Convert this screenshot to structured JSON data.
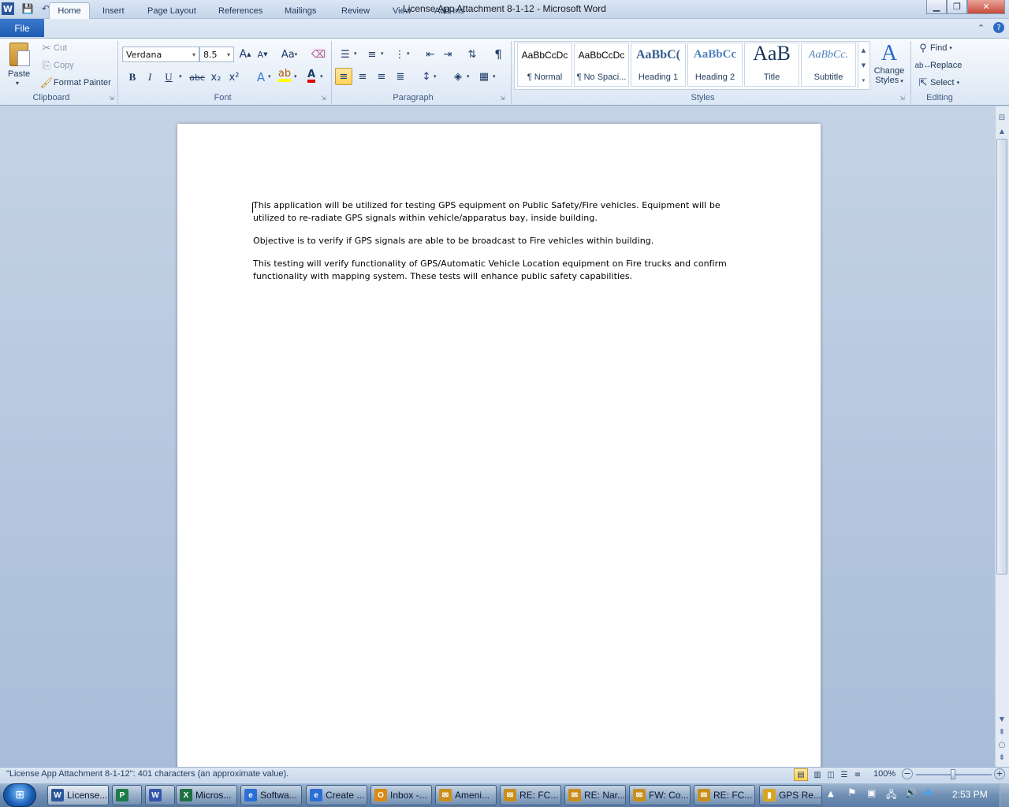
{
  "window": {
    "title": "License App Attachment 8-1-12  -  Microsoft Word"
  },
  "qat": {
    "save_icon": "save-icon",
    "undo_icon": "undo-icon",
    "redo_icon": "redo-icon"
  },
  "tabs": [
    {
      "label": "File"
    },
    {
      "label": "Home"
    },
    {
      "label": "Insert"
    },
    {
      "label": "Page Layout"
    },
    {
      "label": "References"
    },
    {
      "label": "Mailings"
    },
    {
      "label": "Review"
    },
    {
      "label": "View"
    },
    {
      "label": "Add-Ins"
    }
  ],
  "clipboard": {
    "group": "Clipboard",
    "paste": "Paste",
    "cut": "Cut",
    "copy": "Copy",
    "format_painter": "Format Painter"
  },
  "font": {
    "group": "Font",
    "name": "Verdana",
    "size": "8.5",
    "bold": "B",
    "italic": "I",
    "underline": "U",
    "strike": "abc",
    "sub": "x₂",
    "sup": "x²",
    "case": "Aa",
    "grow": "A",
    "shrink": "A"
  },
  "paragraph": {
    "group": "Paragraph",
    "pilcrow": "¶"
  },
  "styles": {
    "group": "Styles",
    "items": [
      {
        "sample": "AaBbCcDc",
        "name": "¶ Normal"
      },
      {
        "sample": "AaBbCcDc",
        "name": "¶ No Spaci..."
      },
      {
        "sample": "AaBbC(",
        "name": "Heading 1"
      },
      {
        "sample": "AaBbCc",
        "name": "Heading 2"
      },
      {
        "sample": "AaB",
        "name": "Title"
      },
      {
        "sample": "AaBbCc.",
        "name": "Subtitle"
      }
    ],
    "change_styles_line1": "Change",
    "change_styles_line2": "Styles"
  },
  "editing": {
    "group": "Editing",
    "find": "Find",
    "replace": "Replace",
    "select": "Select"
  },
  "document": {
    "paragraphs": [
      "This application will be utilized for testing GPS equipment on Public Safety/Fire vehicles. Equipment will be utilized to re-radiate GPS signals within vehicle/apparatus bay, inside building.",
      "Objective is to verify if GPS signals are able to be broadcast to Fire vehicles within building.",
      "This testing will verify functionality of GPS/Automatic Vehicle Location equipment on Fire trucks and confirm functionality with mapping system. These tests will enhance public safety capabilities."
    ]
  },
  "status": {
    "text": "\"License App Attachment 8-1-12\": 401 characters (an approximate value).",
    "zoom": "100%",
    "zoom_level_percent": 100
  },
  "taskbar": {
    "items": [
      {
        "label": "License...",
        "icon": "W",
        "color": "#2b579a"
      },
      {
        "label": "",
        "icon": "P",
        "color": "#1f7a4a"
      },
      {
        "label": "",
        "icon": "W",
        "color": "#3355aa"
      },
      {
        "label": "Micros...",
        "icon": "X",
        "color": "#1e7145"
      },
      {
        "label": "Softwa...",
        "icon": "e",
        "color": "#2a6fd6"
      },
      {
        "label": "Create ...",
        "icon": "e",
        "color": "#2a6fd6"
      },
      {
        "label": "Inbox -...",
        "icon": "O",
        "color": "#d98a12"
      },
      {
        "label": "Ameni...",
        "icon": "✉",
        "color": "#c98f1c"
      },
      {
        "label": "RE: FC...",
        "icon": "✉",
        "color": "#c98f1c"
      },
      {
        "label": "RE: Nar...",
        "icon": "✉",
        "color": "#c98f1c"
      },
      {
        "label": "FW: Co...",
        "icon": "✉",
        "color": "#c98f1c"
      },
      {
        "label": "RE: FC...",
        "icon": "✉",
        "color": "#c98f1c"
      },
      {
        "label": "GPS Re...",
        "icon": "▮",
        "color": "#d9a520"
      }
    ],
    "clock": "2:53 PM"
  }
}
